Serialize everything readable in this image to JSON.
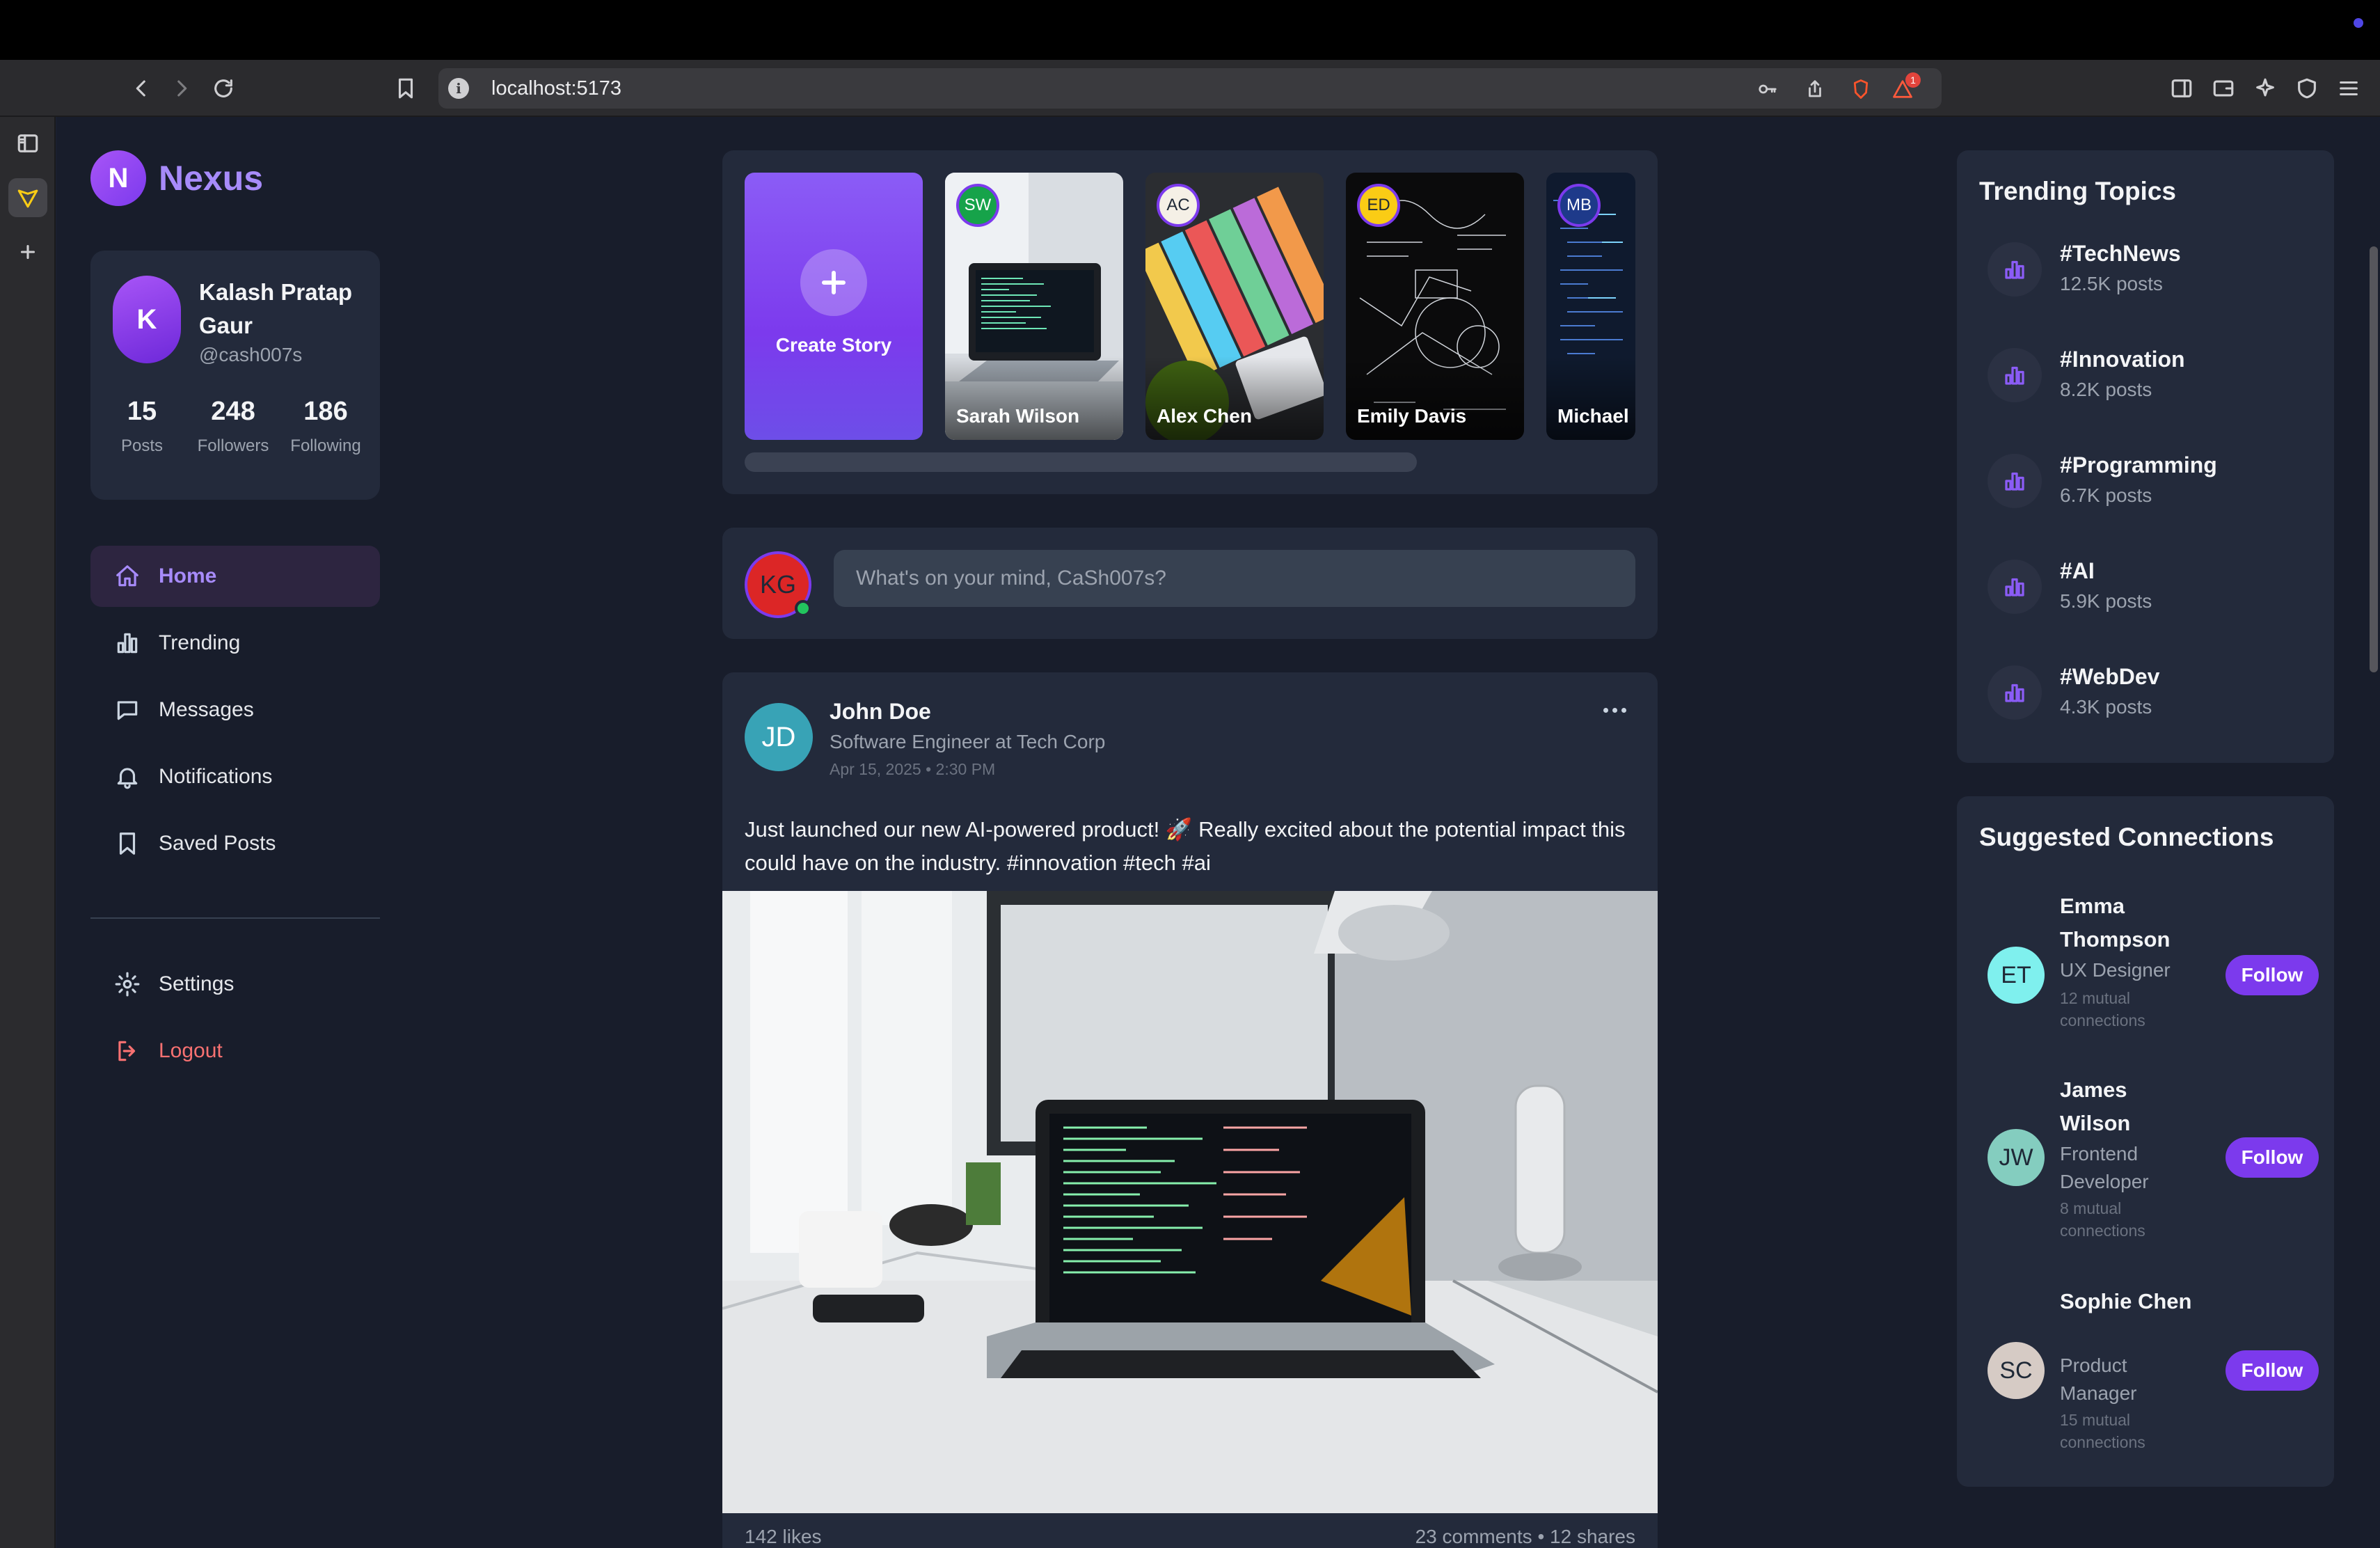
{
  "browser": {
    "url": "localhost:5173",
    "shield_badge": "1"
  },
  "app": {
    "logo_letter": "N",
    "name": "Nexus",
    "accent": "#7c3aed"
  },
  "profile": {
    "initial": "K",
    "name": "Kalash Pratap Gaur",
    "handle": "@cash007s",
    "stats": [
      {
        "value": "15",
        "label": "Posts"
      },
      {
        "value": "248",
        "label": "Followers"
      },
      {
        "value": "186",
        "label": "Following"
      }
    ]
  },
  "nav": {
    "items": [
      {
        "label": "Home",
        "icon": "home-icon"
      },
      {
        "label": "Trending",
        "icon": "bar-chart-icon"
      },
      {
        "label": "Messages",
        "icon": "message-icon"
      },
      {
        "label": "Notifications",
        "icon": "bell-icon"
      },
      {
        "label": "Saved Posts",
        "icon": "bookmark-icon"
      }
    ],
    "settings": "Settings",
    "logout": "Logout"
  },
  "stories": {
    "create_label": "Create Story",
    "items": [
      {
        "initials": "SW",
        "name": "Sarah Wilson",
        "avatar_color": "#16a34a"
      },
      {
        "initials": "AC",
        "name": "Alex Chen",
        "avatar_color": "#f5f0e6"
      },
      {
        "initials": "ED",
        "name": "Emily Davis",
        "avatar_color": "#facc15"
      },
      {
        "initials": "MB",
        "name": "Michael",
        "avatar_color": "#1e3a8a"
      }
    ]
  },
  "composer": {
    "avatar_initials": "KG",
    "placeholder": "What's on your mind, CaSh007s?"
  },
  "post": {
    "avatar_initials": "JD",
    "author": "John Doe",
    "role": "Software Engineer at Tech Corp",
    "time": "Apr 15, 2025 • 2:30 PM",
    "text": "Just launched our new AI-powered product! 🚀 Really excited about the potential impact this could have on the industry. #innovation #tech #ai",
    "likes": "142 likes",
    "comments_shares": "23 comments  •  12 shares"
  },
  "trending": {
    "title": "Trending Topics",
    "items": [
      {
        "tag": "#TechNews",
        "count": "12.5K posts"
      },
      {
        "tag": "#Innovation",
        "count": "8.2K posts"
      },
      {
        "tag": "#Programming",
        "count": "6.7K posts"
      },
      {
        "tag": "#AI",
        "count": "5.9K posts"
      },
      {
        "tag": "#WebDev",
        "count": "4.3K posts"
      }
    ]
  },
  "suggestions": {
    "title": "Suggested Connections",
    "follow_label": "Follow",
    "items": [
      {
        "initials": "ET",
        "name": "Emma Thompson",
        "role": "UX Designer",
        "mutual": "12 mutual connections",
        "avatar_color": "#7ff0ee"
      },
      {
        "initials": "JW",
        "name": "James Wilson",
        "role": "Frontend Developer",
        "mutual": "8 mutual connections",
        "avatar_color": "#84cdbf"
      },
      {
        "initials": "SC",
        "name": "Sophie Chen",
        "role": "Product Manager",
        "mutual": "15 mutual connections",
        "avatar_color": "#d6cbc5"
      }
    ]
  }
}
